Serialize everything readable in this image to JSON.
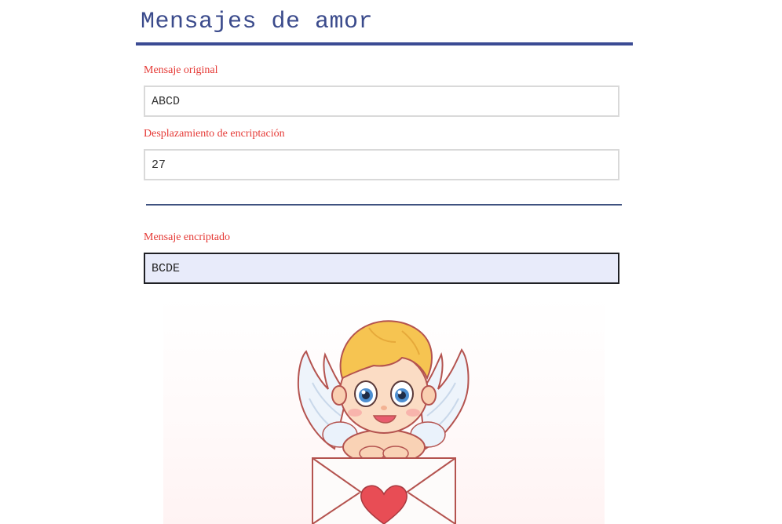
{
  "header": {
    "title": "Mensajes de amor"
  },
  "form": {
    "original_label": "Mensaje original",
    "original_value": "ABCD",
    "shift_label": "Desplazamiento de encriptación",
    "shift_value": "27",
    "encrypted_label": "Mensaje encriptado",
    "encrypted_value": "BCDE"
  },
  "colors": {
    "title": "#3b4b8c",
    "label": "#e53935",
    "rule": "#3b4b94",
    "output_background": "#e8ebfa"
  },
  "illustration": {
    "icon": "cupid-with-love-letter"
  }
}
